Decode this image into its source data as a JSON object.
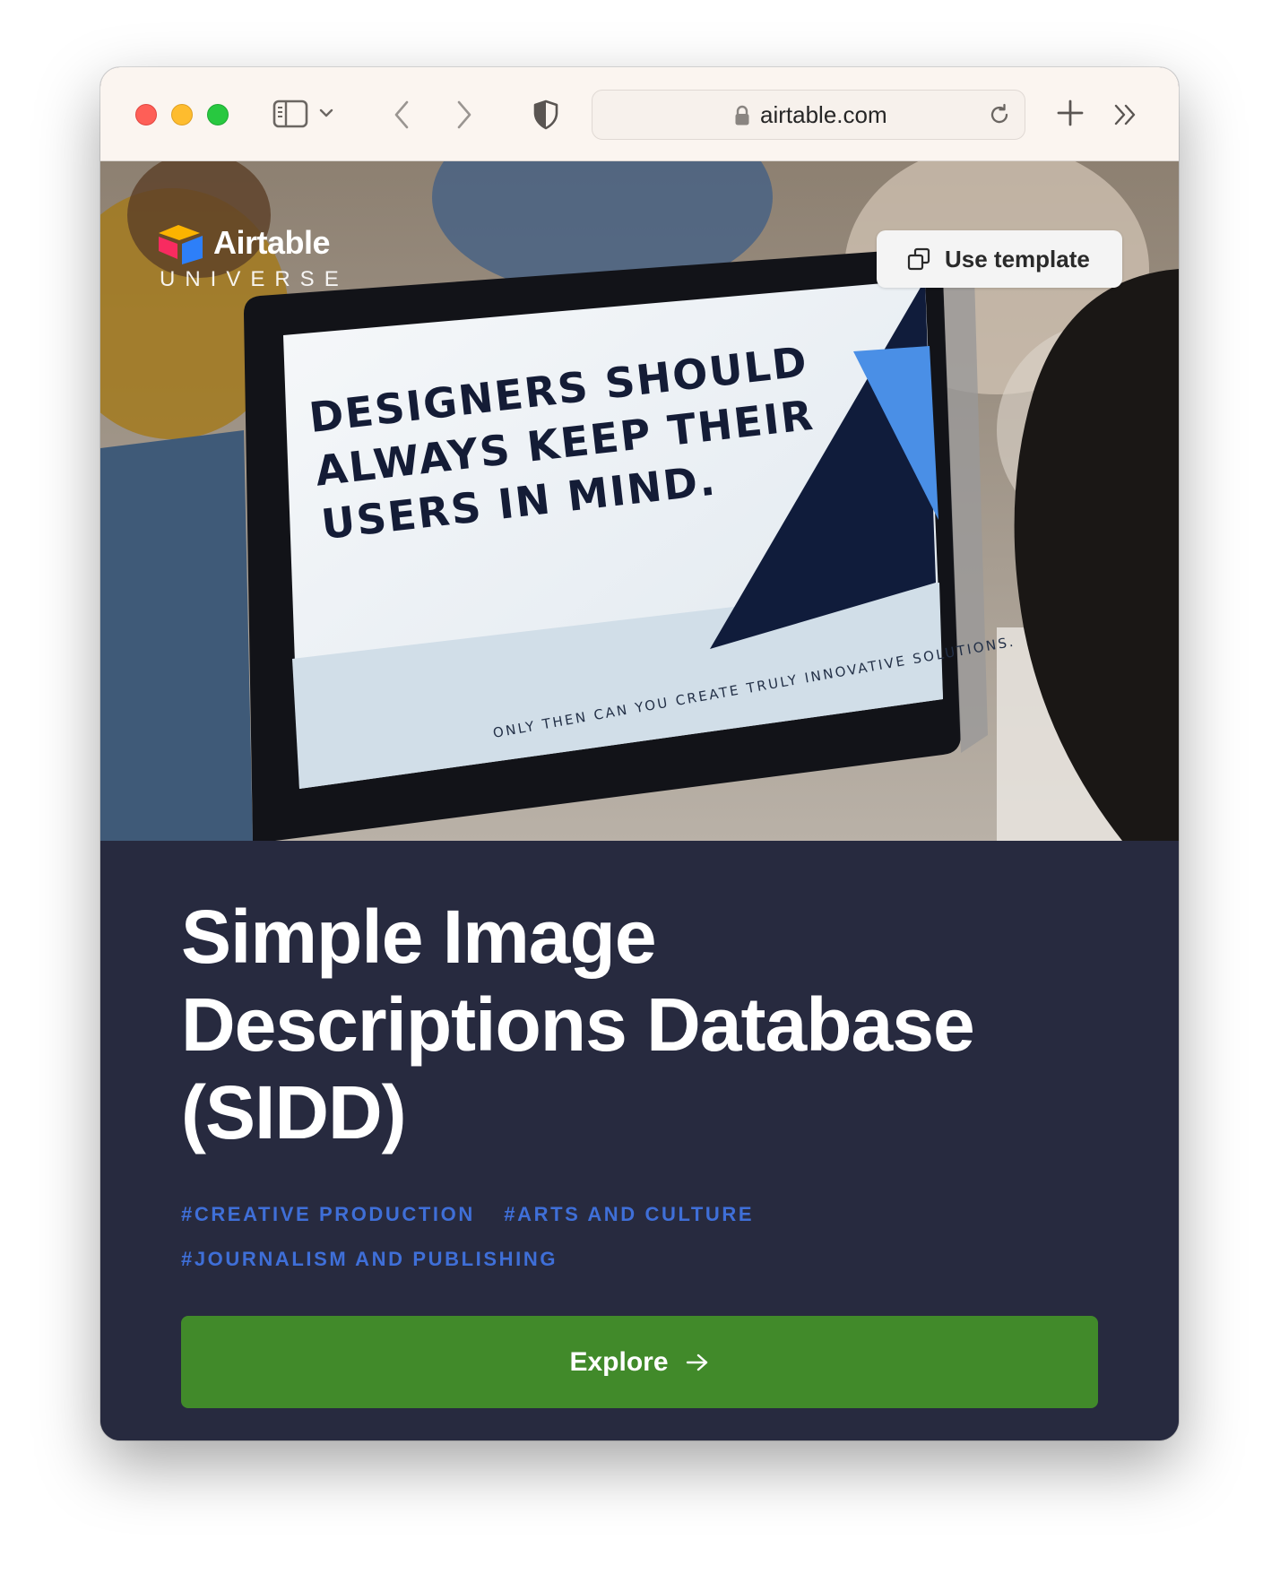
{
  "browser": {
    "url": "airtable.com",
    "icons": [
      "sidebar-icon",
      "chevron-down-icon",
      "back-icon",
      "forward-icon",
      "shield-icon",
      "lock-icon",
      "reload-icon",
      "new-tab-icon",
      "more-icon"
    ]
  },
  "hero": {
    "logo_word": "Airtable",
    "logo_sub": "UNIVERSE",
    "use_template_label": "Use template",
    "screen_headline": [
      "DESIGNERS SHOULD",
      "ALWAYS KEEP THEIR",
      "USERS IN MIND."
    ],
    "screen_subline": "ONLY THEN CAN YOU CREATE TRULY INNOVATIVE SOLUTIONS."
  },
  "content": {
    "title": "Simple Image Descriptions Database (SIDD)",
    "tags": [
      "#CREATIVE PRODUCTION",
      "#ARTS AND CULTURE",
      "#JOURNALISM AND PUBLISHING"
    ],
    "explore_label": "Explore"
  },
  "colors": {
    "accent_green": "#418a2a",
    "tag_blue": "#3f6fd8",
    "panel_dark": "#272a3f"
  }
}
